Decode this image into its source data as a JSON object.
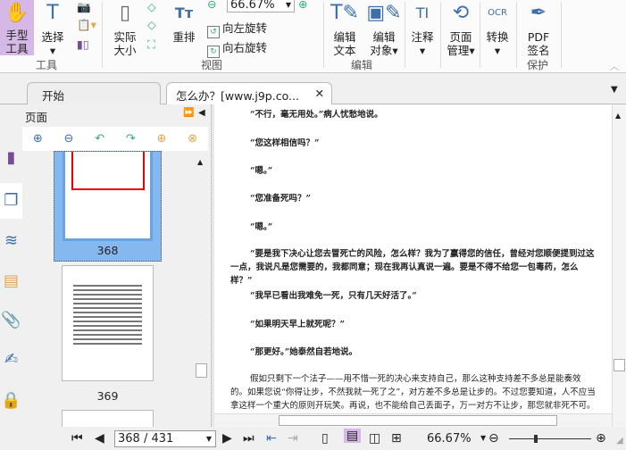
{
  "ribbon": {
    "tools": {
      "hand": "手型工具",
      "hand_l1": "手型",
      "hand_l2": "工具",
      "select": "选择",
      "group": "工具"
    },
    "view": {
      "actual_size_l1": "实际",
      "actual_size_l2": "大小",
      "reflow": "重排",
      "zoom_value": "66.67%",
      "rotate_left": "向左旋转",
      "rotate_right": "向右旋转",
      "group": "视图"
    },
    "edit": {
      "edit_text_l1": "编辑",
      "edit_text_l2": "文本",
      "edit_object_l1": "编辑",
      "edit_object_l2": "对象",
      "group": "编辑"
    },
    "comment": "注释",
    "page_mgmt_l1": "页面",
    "page_mgmt_l2": "管理",
    "convert": "转换",
    "sign_l1": "PDF",
    "sign_l2": "签名",
    "protect_group": "保护"
  },
  "tabs": [
    {
      "label": "开始"
    },
    {
      "label": "怎么办？[www.j9p.co..."
    }
  ],
  "sidebar": {
    "title": "页面",
    "pages": [
      "368",
      "369"
    ]
  },
  "document": {
    "lines": [
      "“不行，毫无用处。”病人忧愁地说。",
      "“您这样相信吗？”",
      "“嗯。”",
      "“您准备死吗？”",
      "“嗯。”"
    ],
    "para1": "“要是我下决心让您去冒死亡的风险，怎么样？我为了赢得您的信任，曾经对您顺便提到过这一点，我说凡是您需要的，我都同意；现在我再认真说一遍。要是不得不给您一包毒药，怎么样？”",
    "lines2": [
      "“我早已看出我难免一死，只有几天好活了。”",
      "“如果明天早上就死呢？”",
      "“那更好。”她泰然自若地说。"
    ],
    "para2": "假如只剩下一个法子——用不惜一死的决心来支持自己，那么这种支持差不多总是能奏效的。如果您说“你得让步，不然我就一死了之”，对方差不多总是让步的。不过您要知道，人不应当拿这样一个重大的原则开玩笑。再说，也不能给自己丢面子，万一对方不让步，那您就非死不可。他向她说明了他的计"
  },
  "status": {
    "page_input": "368 / 431",
    "zoom": "66.67%",
    "zoom_slider_fraction": 0.33
  },
  "colors": {
    "accent": "#d5b8e6",
    "selected_thumb": "#86b8f0"
  }
}
